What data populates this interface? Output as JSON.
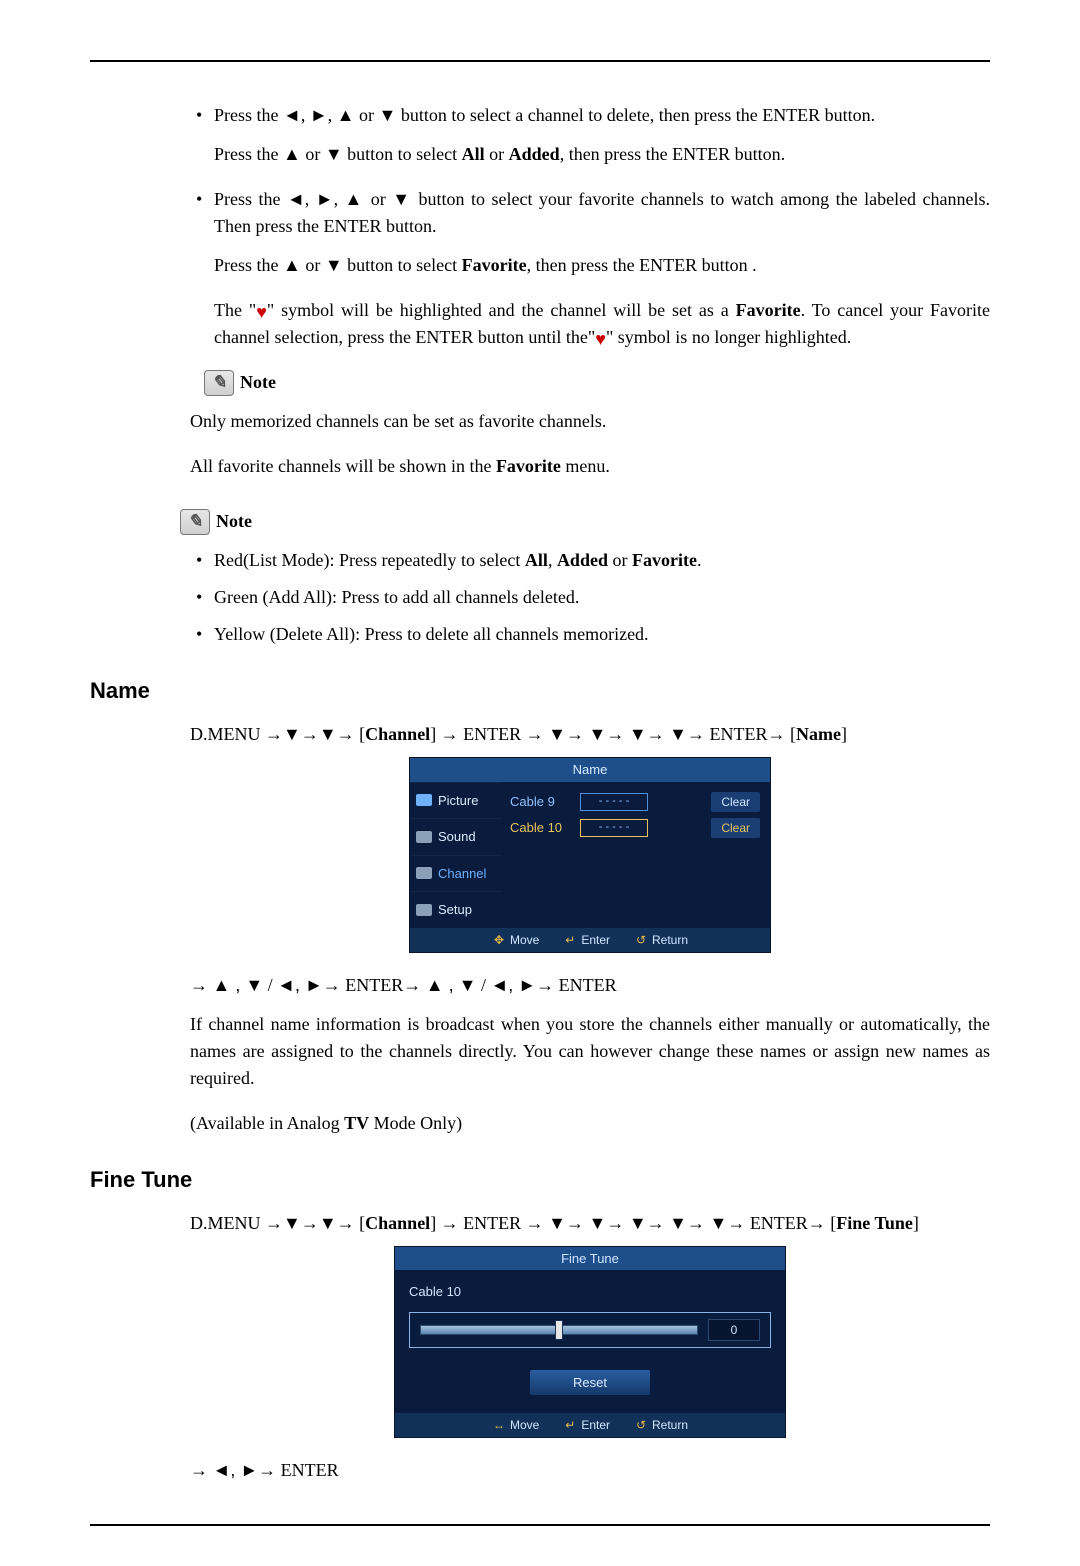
{
  "bullets1": {
    "item1_pre": "Press the ",
    "item1_post": " button to select a channel to delete, then press the ENTER button.",
    "item1_sub_pre": "Press the ",
    "item1_sub_mid": " button to select ",
    "item1_sub_all": "All",
    "item1_sub_or": " or ",
    "item1_sub_added": "Added",
    "item1_sub_end": ", then press the ENTER button.",
    "item2_pre": "Press the ",
    "item2_post": " button to select your favorite channels to watch among the labeled channels. Then press the ENTER button.",
    "item2_sub_pre": "Press the ",
    "item2_sub_mid": " button to select ",
    "item2_sub_fav": "Favorite",
    "item2_sub_end": ", then press the ENTER button .",
    "heart_para_a": "The \"",
    "heart_para_b": "\" symbol will be highlighted and the channel will be set as a ",
    "heart_para_fav": "Favorite",
    "heart_para_c": ". To cancel your Favorite channel selection, press the ENTER button until the\"",
    "heart_para_d": "\" symbol is no longer highlighted."
  },
  "note_label": "Note",
  "note_lines": {
    "a": "Only memorized channels can be set as favorite channels.",
    "b_pre": "All favorite channels will be shown in the ",
    "b_fav": "Favorite",
    "b_post": " menu."
  },
  "bullets2": {
    "a_pre": "Red(List Mode): Press repeatedly to select ",
    "a_all": "All",
    "a_c1": ", ",
    "a_added": "Added",
    "a_or": " or ",
    "a_fav": "Favorite",
    "a_end": ".",
    "b": "Green (Add All): Press to add all channels deleted.",
    "c": "Yellow (Delete All): Press to delete all channels memorized."
  },
  "sections": {
    "name": "Name",
    "finetune": "Fine Tune"
  },
  "name_path": {
    "a": "D.MENU →",
    "b": "→",
    "c": "→ [",
    "channel": "Channel",
    "d": "] → ENTER → ",
    "e": "→ ",
    "f": "→ ",
    "g": "→ ",
    "h": "→ ENTER→ [",
    "name": "Name",
    "i": "]"
  },
  "name_nav": {
    "pre": "→ ",
    "mid": " / ",
    "arrow_enter": "→ ENTER→ ",
    "mid2": " / ",
    "end": "→ ENTER"
  },
  "name_desc": "If channel name information is broadcast when you store the channels either manually or automatically, the names are assigned to the channels directly. You can however change these names or assign new names as required.",
  "name_avail_pre": "(Available in Analog ",
  "name_avail_tv": "TV",
  "name_avail_post": " Mode Only)",
  "ft_path": {
    "a": "D.MENU →",
    "b": "→",
    "c": "→ [",
    "channel": "Channel",
    "d": "] → ENTER → ",
    "e": "→ ",
    "f": "→ ",
    "g": "→ ",
    "h": "→ ",
    "i": "→ ENTER→ [",
    "ft": "Fine Tune",
    "j": "]"
  },
  "ft_nav": {
    "pre": "→ ",
    "end": "→ ENTER"
  },
  "osd_name": {
    "title": "Name",
    "side": {
      "picture": "Picture",
      "sound": "Sound",
      "channel": "Channel",
      "setup": "Setup"
    },
    "rows": [
      {
        "ch": "Cable  9",
        "val": "- - - - -",
        "clear": "Clear"
      },
      {
        "ch": "Cable  10",
        "val": "- - - - -",
        "clear": "Clear"
      }
    ],
    "footer": {
      "move": "Move",
      "enter": "Enter",
      "return": "Return"
    }
  },
  "osd_ft": {
    "title": "Fine Tune",
    "channel": "Cable 10",
    "value": "0",
    "reset": "Reset",
    "footer": {
      "move": "Move",
      "enter": "Enter",
      "return": "Return"
    }
  },
  "glyphs": {
    "left": "◄",
    "right": "►",
    "up": "▲",
    "down": "▼",
    "comma": ", ",
    "or": " or ",
    "updown": "▲ , ▼",
    "leftright": "◄, ►"
  }
}
